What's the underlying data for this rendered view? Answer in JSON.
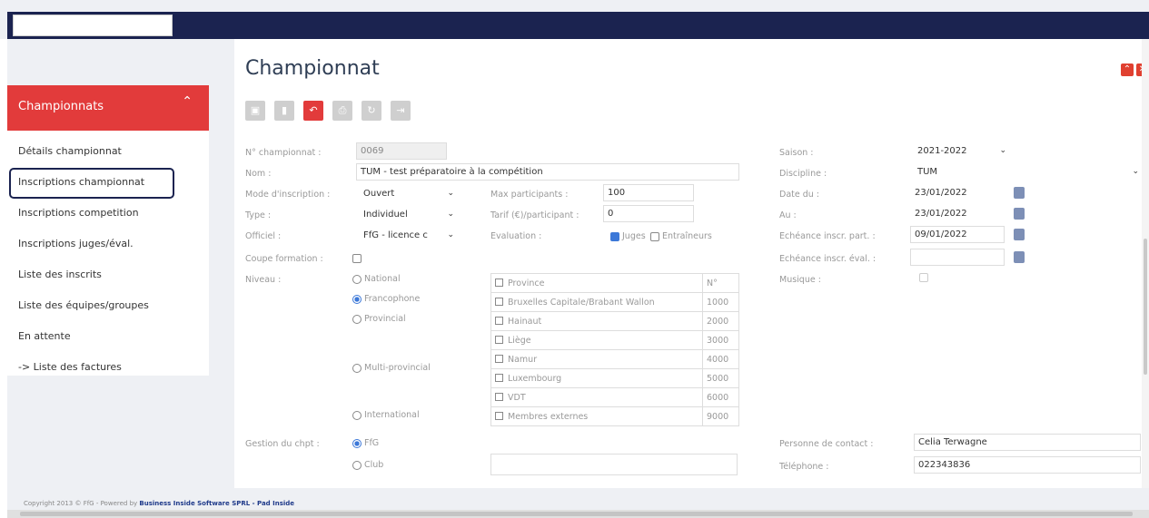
{
  "app": {
    "search_value": ""
  },
  "page": {
    "title": "Championnat"
  },
  "sidebar": {
    "header": "Championnats",
    "items": [
      {
        "label": "Détails championnat"
      },
      {
        "label": "Inscriptions championnat"
      },
      {
        "label": "Inscriptions competition"
      },
      {
        "label": "Inscriptions juges/éval."
      },
      {
        "label": "Liste des inscrits"
      },
      {
        "label": "Liste des équipes/groupes"
      },
      {
        "label": "En attente"
      },
      {
        "label": "-> Liste des factures"
      }
    ]
  },
  "form": {
    "num_label": "N° championnat :",
    "num_value": "0069",
    "nom_label": "Nom :",
    "nom_value": "TUM - test préparatoire à la compétition",
    "mode_label": "Mode d'inscription :",
    "mode_value": "Ouvert",
    "max_label": "Max participants :",
    "max_value": "100",
    "type_label": "Type :",
    "type_value": "Individuel",
    "tarif_label": "Tarif (€)/participant :",
    "tarif_value": "0",
    "officiel_label": "Officiel :",
    "officiel_value": "FfG - licence c",
    "evaluation_label": "Evaluation :",
    "juges_label": "Juges",
    "entraineurs_label": "Entraîneurs",
    "coupe_label": "Coupe formation :",
    "niveau_label": "Niveau :",
    "niveau_options": [
      "National",
      "Francophone",
      "Provincial",
      "Multi-provincial",
      "International"
    ],
    "gestion_label": "Gestion du chpt :",
    "gestion_options": [
      "FfG",
      "Club"
    ],
    "saison_label": "Saison :",
    "saison_value": "2021-2022",
    "discipline_label": "Discipline :",
    "discipline_value": "TUM",
    "date_du_label": "Date du :",
    "date_du_value": "23/01/2022",
    "au_label": "Au :",
    "au_value": "23/01/2022",
    "ech_part_label": "Echéance inscr. part. :",
    "ech_part_value": "09/01/2022",
    "ech_eval_label": "Echéance inscr. éval. :",
    "musique_label": "Musique :",
    "contact_label": "Personne de contact :",
    "contact_value": "Celia Terwagne",
    "telephone_label": "Téléphone :",
    "telephone_value": "022343836"
  },
  "provinces": {
    "header_name": "Province",
    "header_num": "N°",
    "rows": [
      {
        "name": "Bruxelles Capitale/Brabant Wallon",
        "num": "1000"
      },
      {
        "name": "Hainaut",
        "num": "2000"
      },
      {
        "name": "Liège",
        "num": "3000"
      },
      {
        "name": "Namur",
        "num": "4000"
      },
      {
        "name": "Luxembourg",
        "num": "5000"
      },
      {
        "name": "VDT",
        "num": "6000"
      },
      {
        "name": "Membres externes",
        "num": "9000"
      }
    ]
  },
  "footer": {
    "copyright": "Copyright 2013 © FfG - Powered by",
    "company": "Business Inside Software SPRL - Pad Inside"
  },
  "colors": {
    "navy": "#1b2350",
    "accent": "#e23b3b",
    "check": "#3c78d8"
  }
}
